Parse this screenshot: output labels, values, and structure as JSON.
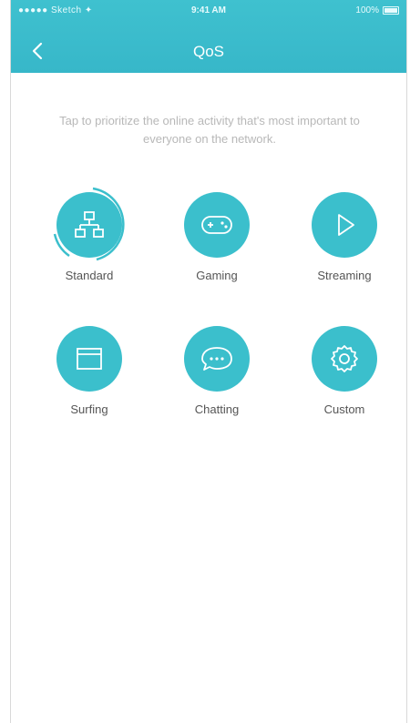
{
  "status_bar": {
    "carrier": "●●●●● Sketch ✦",
    "time": "9:41 AM",
    "battery": "100%"
  },
  "header": {
    "title": "QoS",
    "back_icon": "chevron-left-icon"
  },
  "hint": "Tap to prioritize the online activity that's most important to everyone on the network.",
  "modes": [
    {
      "label": "Standard",
      "icon": "network-icon",
      "selected": true
    },
    {
      "label": "Gaming",
      "icon": "gamepad-icon",
      "selected": false
    },
    {
      "label": "Streaming",
      "icon": "play-icon",
      "selected": false
    },
    {
      "label": "Surfing",
      "icon": "browser-window-icon",
      "selected": false
    },
    {
      "label": "Chatting",
      "icon": "chat-bubble-icon",
      "selected": false
    },
    {
      "label": "Custom",
      "icon": "gear-icon",
      "selected": false
    }
  ],
  "colors": {
    "accent": "#3bbfcc",
    "header": "#3fc1cf"
  }
}
